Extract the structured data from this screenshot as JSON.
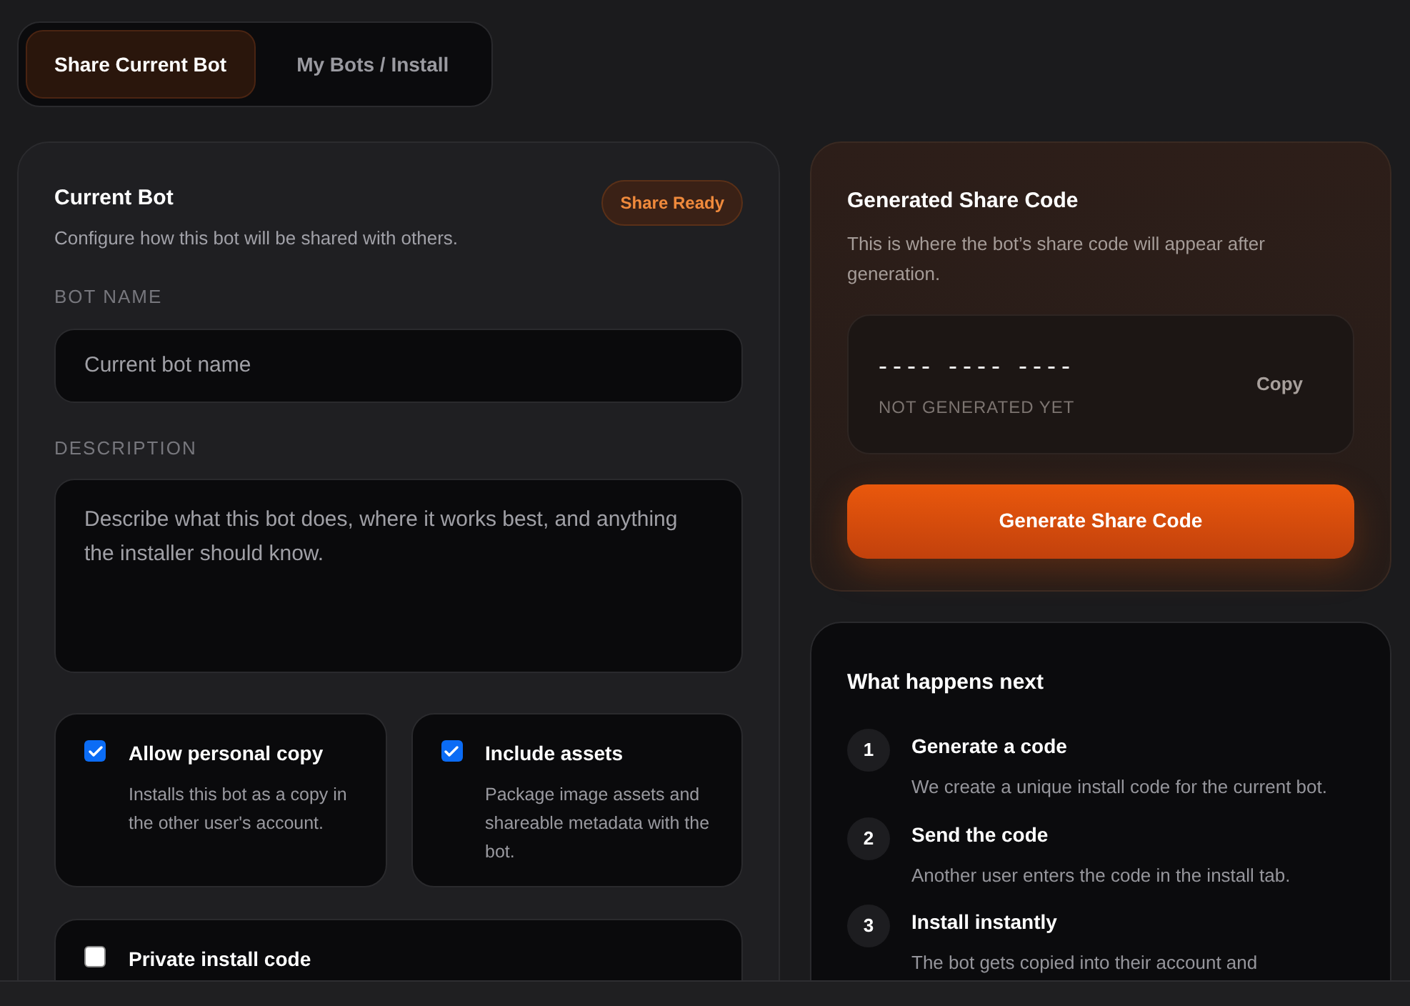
{
  "tabs": [
    {
      "label": "Share Current Bot",
      "selected": true
    },
    {
      "label": "My Bots / Install",
      "selected": false
    }
  ],
  "current_bot": {
    "title": "Current Bot",
    "subtitle": "Configure how this bot will be shared with others.",
    "badge": "Share Ready",
    "fields": [
      {
        "kind": "input",
        "label": "BOT NAME",
        "placeholder": "Current bot name"
      },
      {
        "kind": "textarea",
        "label": "DESCRIPTION",
        "placeholder": "Describe what this bot does, where it works best, and anything the installer should know."
      }
    ],
    "options": [
      {
        "label": "Allow personal copy",
        "description": "Installs this bot as a copy in the other user's account.",
        "checked": true
      },
      {
        "label": "Include assets",
        "description": "Package image assets and shareable metadata with the bot.",
        "checked": true
      },
      {
        "label": "Private install code",
        "checked": false
      }
    ]
  },
  "share_code": {
    "title": "Generated Share Code",
    "subtitle": "This is where the bot’s share code will appear after generation.",
    "code": "---- ---- ----",
    "status": "NOT GENERATED YET",
    "copy": "Copy",
    "generate": "Generate Share Code"
  },
  "next_steps": {
    "title": "What happens next",
    "steps": [
      {
        "number": "1",
        "title": "Generate a code",
        "description": "We create a unique install code for the current bot."
      },
      {
        "number": "2",
        "title": "Send the code",
        "description": "Another user enters the code in the install tab."
      },
      {
        "number": "3",
        "title": "Install instantly",
        "description": "The bot gets copied into their account and"
      }
    ]
  }
}
